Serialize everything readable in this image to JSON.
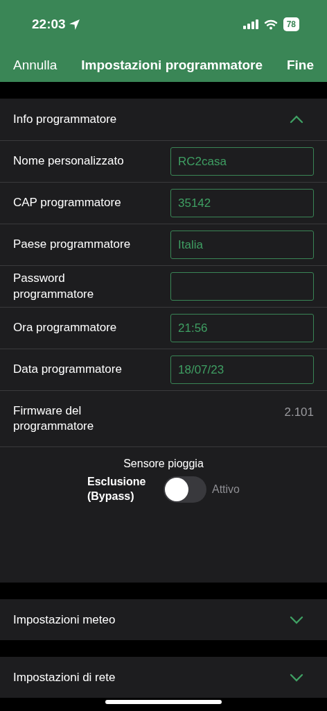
{
  "status_bar": {
    "time": "22:03",
    "battery": "78"
  },
  "nav": {
    "cancel": "Annulla",
    "title": "Impostazioni programmatore",
    "done": "Fine"
  },
  "sections": [
    {
      "title": "Info programmatore",
      "expanded": true,
      "fields": [
        {
          "kind": "input",
          "label": "Nome personalizzato",
          "value": "RC2casa"
        },
        {
          "kind": "input",
          "label": "CAP programmatore",
          "value": "35142"
        },
        {
          "kind": "input",
          "label": "Paese programmatore",
          "value": "Italia"
        },
        {
          "kind": "input",
          "label": "Password programmatore"
        },
        {
          "kind": "input",
          "label": "Ora programmatore",
          "value": "21:56"
        },
        {
          "kind": "input",
          "label": "Data programmatore",
          "value": "18/07/23"
        },
        {
          "kind": "readonly",
          "label": "Firmware del programmatore",
          "value": "2.101"
        }
      ],
      "rain_sensor": {
        "title": "Sensore pioggia",
        "off_label": "Esclusione (Bypass)",
        "on_label": "Attivo",
        "on": false
      }
    },
    {
      "title": "Impostazioni meteo",
      "expanded": false
    },
    {
      "title": "Impostazioni di rete",
      "expanded": false
    }
  ]
}
